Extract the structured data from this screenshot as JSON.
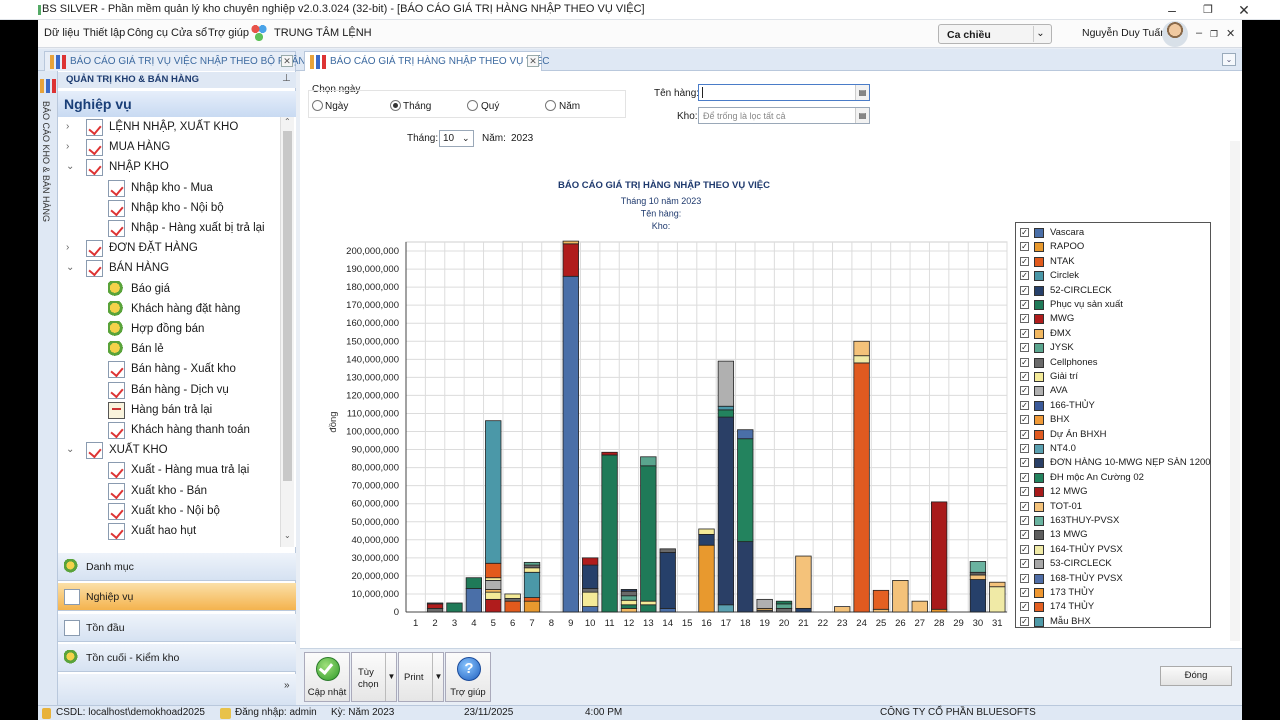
{
  "window": {
    "title": "BS SILVER - Phần mềm quản lý kho chuyên nghiệp v2.0.3.024 (32-bit) - [BÁO CÁO GIÁ TRỊ HÀNG NHẬP THEO VỤ VIỆC]"
  },
  "menu": {
    "items": [
      "Dữ liệu",
      "Thiết lập",
      "Công cụ",
      "Cửa sổ",
      "Trợ giúp"
    ],
    "command_center": "TRUNG TÂM LỆNH"
  },
  "shift": {
    "value": "Ca chiều"
  },
  "user": {
    "name": "Nguyễn Duy Tuấn"
  },
  "tabs": [
    {
      "label": "BÁO CÁO GIÁ TRỊ VỤ VIỆC NHẬP THEO BỘ PHẬN"
    },
    {
      "label": "BÁO CÁO GIÁ TRỊ HÀNG NHẬP THEO VỤ VIỆC"
    }
  ],
  "sidebar": {
    "strip_label": "BÁO CÁO KHO & BÁN HÀNG",
    "header": "QUẢN TRỊ KHO & BÁN HÀNG",
    "group": "Nghiệp vụ",
    "tree": [
      {
        "label": "LỆNH NHẬP, XUẤT KHO",
        "level": 0,
        "exp": "›",
        "icon": "doc"
      },
      {
        "label": "MUA HÀNG",
        "level": 0,
        "exp": "›",
        "icon": "doc"
      },
      {
        "label": "NHẬP KHO",
        "level": 0,
        "exp": "⌄",
        "icon": "doc"
      },
      {
        "label": "Nhập kho - Mua",
        "level": 1,
        "exp": "",
        "icon": "doc"
      },
      {
        "label": "Nhập kho - Nội bộ",
        "level": 1,
        "exp": "",
        "icon": "doc"
      },
      {
        "label": "Nhập - Hàng xuất bị trả lại",
        "level": 1,
        "exp": "",
        "icon": "doc"
      },
      {
        "label": "ĐƠN ĐẶT HÀNG",
        "level": 0,
        "exp": "›",
        "icon": "doc"
      },
      {
        "label": "BÁN HÀNG",
        "level": 0,
        "exp": "⌄",
        "icon": "doc"
      },
      {
        "label": "Báo giá",
        "level": 1,
        "exp": "",
        "icon": "gear"
      },
      {
        "label": "Khách hàng đặt hàng",
        "level": 1,
        "exp": "",
        "icon": "gear"
      },
      {
        "label": "Hợp đồng bán",
        "level": 1,
        "exp": "",
        "icon": "gear"
      },
      {
        "label": "Bán lẻ",
        "level": 1,
        "exp": "",
        "icon": "gear"
      },
      {
        "label": "Bán hàng - Xuất kho",
        "level": 1,
        "exp": "",
        "icon": "doc"
      },
      {
        "label": "Bán hàng - Dịch vụ",
        "level": 1,
        "exp": "",
        "icon": "doc"
      },
      {
        "label": "Hàng bán trả lại",
        "level": 1,
        "exp": "",
        "icon": "box"
      },
      {
        "label": "Khách hàng thanh toán",
        "level": 1,
        "exp": "",
        "icon": "doc"
      },
      {
        "label": "XUẤT KHO",
        "level": 0,
        "exp": "⌄",
        "icon": "doc"
      },
      {
        "label": "Xuất - Hàng mua trả lại",
        "level": 1,
        "exp": "",
        "icon": "doc"
      },
      {
        "label": "Xuất kho - Bán",
        "level": 1,
        "exp": "",
        "icon": "doc"
      },
      {
        "label": "Xuất kho - Nội bộ",
        "level": 1,
        "exp": "",
        "icon": "doc"
      },
      {
        "label": "Xuất hao hụt",
        "level": 1,
        "exp": "",
        "icon": "doc"
      }
    ],
    "nav": [
      {
        "label": "Danh mục",
        "active": false
      },
      {
        "label": "Nghiệp vụ",
        "active": true
      },
      {
        "label": "Tồn đầu",
        "active": false
      },
      {
        "label": "Tồn cuối - Kiểm kho",
        "active": false
      }
    ]
  },
  "filters": {
    "period_label": "Chọn ngày",
    "options": [
      "Ngày",
      "Tháng",
      "Quý",
      "Năm"
    ],
    "selected": "Tháng",
    "month_label": "Tháng:",
    "month_value": "10",
    "year_label": "Năm:",
    "year_value": "2023",
    "item_label": "Tên hàng:",
    "item_value": "",
    "warehouse_label": "Kho:",
    "warehouse_placeholder": "Để trống là lọc tất cả"
  },
  "chart_data": {
    "type": "bar",
    "stacked": true,
    "title": "BÁO CÁO GIÁ TRỊ HÀNG NHẬP THEO VỤ VIỆC",
    "subtitle_lines": [
      "Tháng 10 năm 2023",
      "Tên hàng:",
      "Kho:"
    ],
    "ylabel": "đồng",
    "xlabel": "",
    "ylim": [
      0,
      200000000
    ],
    "ytick_step": 10000000,
    "grid": true,
    "legend_position": "right",
    "categories": [
      "1",
      "2",
      "3",
      "4",
      "5",
      "6",
      "7",
      "8",
      "9",
      "10",
      "11",
      "12",
      "13",
      "14",
      "15",
      "16",
      "17",
      "18",
      "19",
      "20",
      "21",
      "22",
      "23",
      "24",
      "25",
      "26",
      "27",
      "28",
      "29",
      "30",
      "31"
    ],
    "series": [
      {
        "name": "Vascara",
        "color": "#4a6fa8"
      },
      {
        "name": "RAPOO",
        "color": "#e8992e"
      },
      {
        "name": "NTAK",
        "color": "#e25a1c"
      },
      {
        "name": "Circlek",
        "color": "#4b98a8"
      },
      {
        "name": "52-CIRCLECK",
        "color": "#26406a"
      },
      {
        "name": "Phục vụ sản xuất",
        "color": "#1f7a58"
      },
      {
        "name": "MWG",
        "color": "#b01c1c"
      },
      {
        "name": "ĐMX",
        "color": "#f2b860"
      },
      {
        "name": "JYSK",
        "color": "#5aa58e"
      },
      {
        "name": "Cellphones",
        "color": "#6a6a6a"
      },
      {
        "name": "Giải trí",
        "color": "#f4ea98"
      },
      {
        "name": "AVA",
        "color": "#b0b0b0"
      },
      {
        "name": "166-THỦY",
        "color": "#3b5a99"
      },
      {
        "name": "BHX",
        "color": "#f09a38"
      },
      {
        "name": "Dự Án BHXH",
        "color": "#e05a20"
      },
      {
        "name": "NT4.0",
        "color": "#5aa0b0"
      },
      {
        "name": "ĐƠN HÀNG 10-MWG NẸP SÀN 1200",
        "color": "#2a3f66"
      },
      {
        "name": "ĐH mộc An Cường 02",
        "color": "#23835e"
      },
      {
        "name": "12 MWG",
        "color": "#a81a1a"
      },
      {
        "name": "TOT-01",
        "color": "#f4c27a"
      },
      {
        "name": "163THUY-PVSX",
        "color": "#6ab3a0"
      },
      {
        "name": "13 MWG",
        "color": "#5e5e5e"
      },
      {
        "name": "164-THỦY PVSX",
        "color": "#f0eaa6"
      },
      {
        "name": "53-CIRCLECK",
        "color": "#a8a8a8"
      },
      {
        "name": "168-THỦY PVSX",
        "color": "#4f6da6"
      },
      {
        "name": "173 THỦY",
        "color": "#ef9730"
      },
      {
        "name": "174 THỦY",
        "color": "#e46022"
      },
      {
        "name": "Mẫu BHX",
        "color": "#4f9aa8"
      }
    ],
    "stacks": [
      [],
      [
        [
          "Cellphones",
          2000000
        ],
        [
          "MWG",
          2500000
        ],
        [
          "Vascara",
          500000
        ]
      ],
      [
        [
          "Phục vụ sản xuất",
          5000000
        ]
      ],
      [
        [
          "Vascara",
          13000000
        ],
        [
          "Phục vụ sản xuất",
          6000000
        ]
      ],
      [
        [
          "MWG",
          7000000
        ],
        [
          "Giải trí",
          4000000
        ],
        [
          "ĐMX",
          1500000
        ],
        [
          "AVA",
          5000000
        ],
        [
          "Giải trí",
          1500000
        ],
        [
          "NTAK",
          8000000
        ],
        [
          "Circlek",
          79000000
        ]
      ],
      [
        [
          "NTAK",
          6000000
        ],
        [
          "Cellphones",
          1500000
        ],
        [
          "Giải trí",
          2500000
        ]
      ],
      [
        [
          "RAPOO",
          6000000
        ],
        [
          "NTAK",
          2000000
        ],
        [
          "Circlek",
          14000000
        ],
        [
          "Giải trí",
          2500000
        ],
        [
          "Cellphones",
          1500000
        ],
        [
          "JYSK",
          1500000
        ]
      ],
      [],
      [
        [
          "Vascara",
          186000000
        ],
        [
          "MWG",
          18000000
        ],
        [
          "ĐMX",
          1500000
        ]
      ],
      [
        [
          "Vascara",
          3000000
        ],
        [
          "Giải trí",
          8000000
        ],
        [
          "Cellphones",
          2000000
        ],
        [
          "52-CIRCLECK",
          13000000
        ],
        [
          "MWG",
          4000000
        ]
      ],
      [
        [
          "Phục vụ sản xuất",
          87000000
        ],
        [
          "MWG",
          1500000
        ]
      ],
      [
        [
          "ĐMX",
          2000000
        ],
        [
          "Phục vụ sản xuất",
          2000000
        ],
        [
          "Giải trí",
          2500000
        ],
        [
          "JYSK",
          2500000
        ],
        [
          "Cellphones",
          2500000
        ],
        [
          "52-CIRCLECK",
          1000000
        ]
      ],
      [
        [
          "Phục vụ sản xuất",
          4000000
        ],
        [
          "Giải trí",
          2000000
        ],
        [
          "Phục vụ sản xuất",
          75000000
        ],
        [
          "JYSK",
          5000000
        ]
      ],
      [
        [
          "Vascara",
          2000000
        ],
        [
          "52-CIRCLECK",
          31000000
        ],
        [
          "Cellphones",
          2000000
        ]
      ],
      [],
      [
        [
          "RAPOO",
          37000000
        ],
        [
          "52-CIRCLECK",
          6000000
        ],
        [
          "Giải trí",
          3000000
        ]
      ],
      [
        [
          "NT4.0",
          4000000
        ],
        [
          "ĐƠN HÀNG 10-MWG NẸP SÀN 1200",
          104000000
        ],
        [
          "ĐH mộc An Cường 02",
          4000000
        ],
        [
          "Circlek",
          2000000
        ],
        [
          "AVA",
          25000000
        ]
      ],
      [
        [
          "ĐƠN HÀNG 10-MWG NẸP SÀN 1200",
          39000000
        ],
        [
          "ĐH mộc An Cường 02",
          57000000
        ],
        [
          "Vascara",
          5000000
        ]
      ],
      [
        [
          "Cellphones",
          1000000
        ],
        [
          "ĐMX",
          1000000
        ],
        [
          "AVA",
          5000000
        ]
      ],
      [
        [
          "Cellphones",
          2000000
        ],
        [
          "JYSK",
          2500000
        ],
        [
          "Phục vụ sản xuất",
          1500000
        ]
      ],
      [
        [
          "52-CIRCLECK",
          2000000
        ],
        [
          "TOT-01",
          29000000
        ]
      ],
      [],
      [
        [
          "TOT-01",
          3000000
        ]
      ],
      [
        [
          "Dự Án BHXH",
          138000000
        ],
        [
          "164-THỦY PVSX",
          4000000
        ],
        [
          "TOT-01",
          8000000
        ]
      ],
      [
        [
          "TOT-01",
          1500000
        ],
        [
          "174 THỦY",
          10500000
        ]
      ],
      [
        [
          "TOT-01",
          17500000
        ]
      ],
      [
        [
          "TOT-01",
          6000000
        ]
      ],
      [
        [
          "RAPOO",
          1500000
        ],
        [
          "12 MWG",
          59500000
        ]
      ],
      [],
      [
        [
          "52-CIRCLECK",
          18000000
        ],
        [
          "TOT-01",
          2500000
        ],
        [
          "13 MWG",
          1500000
        ],
        [
          "163THUY-PVSX",
          6000000
        ]
      ],
      [
        [
          "164-THỦY PVSX",
          14000000
        ],
        [
          "TOT-01",
          2500000
        ]
      ]
    ]
  },
  "toolbar": {
    "update": "Cập nhật",
    "options": "Tùy\nchọn",
    "print": "Print",
    "help": "Trợ giúp",
    "close": "Đóng"
  },
  "status": {
    "db": "CSDL: localhost\\demokhoad2025",
    "login": "Đăng nhập: admin",
    "period": "Kỳ: Năm 2023",
    "date": "23/11/2025",
    "time": "4:00 PM",
    "company": "CÔNG TY CỔ PHẦN BLUESOFTS"
  }
}
